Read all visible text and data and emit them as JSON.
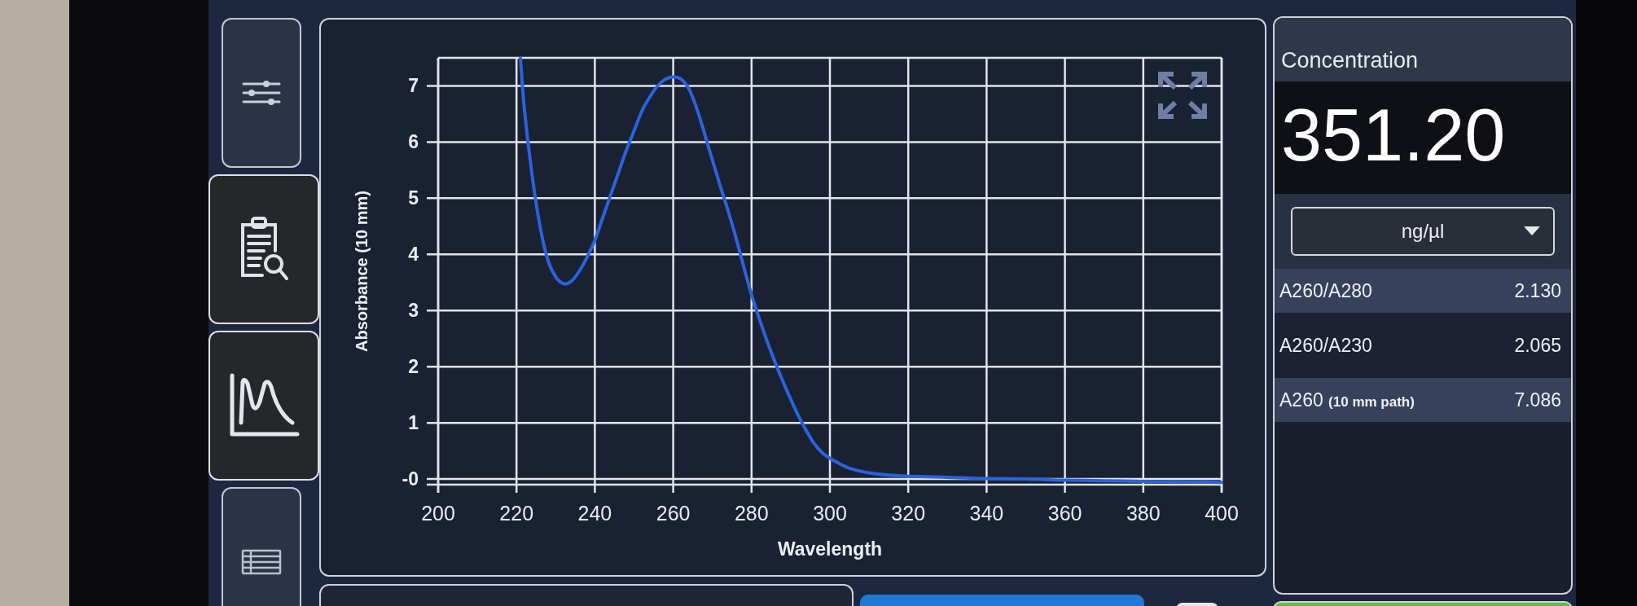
{
  "sidebar": {
    "tabs": [
      {
        "kind": "settings",
        "selected": false
      },
      {
        "kind": "report",
        "selected": true
      },
      {
        "kind": "spectrum",
        "selected": true
      },
      {
        "kind": "table",
        "selected": false
      }
    ]
  },
  "chart_panel": {
    "chart_data": {
      "type": "line",
      "xlabel": "Wavelength",
      "ylabel": "Absorbance (10 mm)",
      "x": [
        221,
        222,
        224,
        226,
        228,
        230,
        232,
        234,
        236,
        238,
        240,
        242,
        244,
        246,
        248,
        250,
        252,
        254,
        256,
        258,
        260,
        262,
        264,
        266,
        268,
        270,
        272,
        274,
        276,
        278,
        280,
        282,
        284,
        286,
        288,
        290,
        292,
        294,
        296,
        298,
        300,
        302,
        304,
        306,
        310,
        315,
        320,
        330,
        340,
        350,
        360,
        370,
        380,
        390,
        400
      ],
      "series": [
        {
          "color": "#2b63dc",
          "values": [
            7.5,
            6.6,
            5.4,
            4.5,
            3.9,
            3.6,
            3.48,
            3.52,
            3.7,
            3.95,
            4.25,
            4.65,
            5.05,
            5.45,
            5.85,
            6.2,
            6.55,
            6.8,
            7.0,
            7.12,
            7.16,
            7.12,
            6.95,
            6.6,
            6.15,
            5.68,
            5.22,
            4.78,
            4.3,
            3.78,
            3.28,
            2.85,
            2.45,
            2.08,
            1.74,
            1.42,
            1.12,
            0.86,
            0.63,
            0.47,
            0.37,
            0.29,
            0.22,
            0.17,
            0.11,
            0.07,
            0.05,
            0.03,
            0.01,
            0.0,
            -0.02,
            -0.03,
            -0.04,
            -0.05,
            -0.06
          ]
        }
      ],
      "xlim": [
        200,
        400
      ],
      "ylim": [
        -0.1,
        7.5
      ],
      "xticks": [
        200,
        220,
        240,
        260,
        280,
        300,
        320,
        340,
        360,
        380,
        400
      ],
      "yticks": [
        {
          "value": 0,
          "label": "-0"
        },
        1,
        2,
        3,
        4,
        5,
        6,
        7
      ],
      "grid": true
    }
  },
  "results": {
    "title": "Concentration",
    "value": "351.20",
    "unit_dropdown": {
      "value": "ng/µl"
    },
    "rows": [
      {
        "label": "A260/A280",
        "value": "2.130"
      },
      {
        "label": "A260/A230",
        "value": "2.065"
      },
      {
        "label": "A260",
        "qualifier": "(10 mm path)",
        "value": "7.086"
      }
    ]
  }
}
